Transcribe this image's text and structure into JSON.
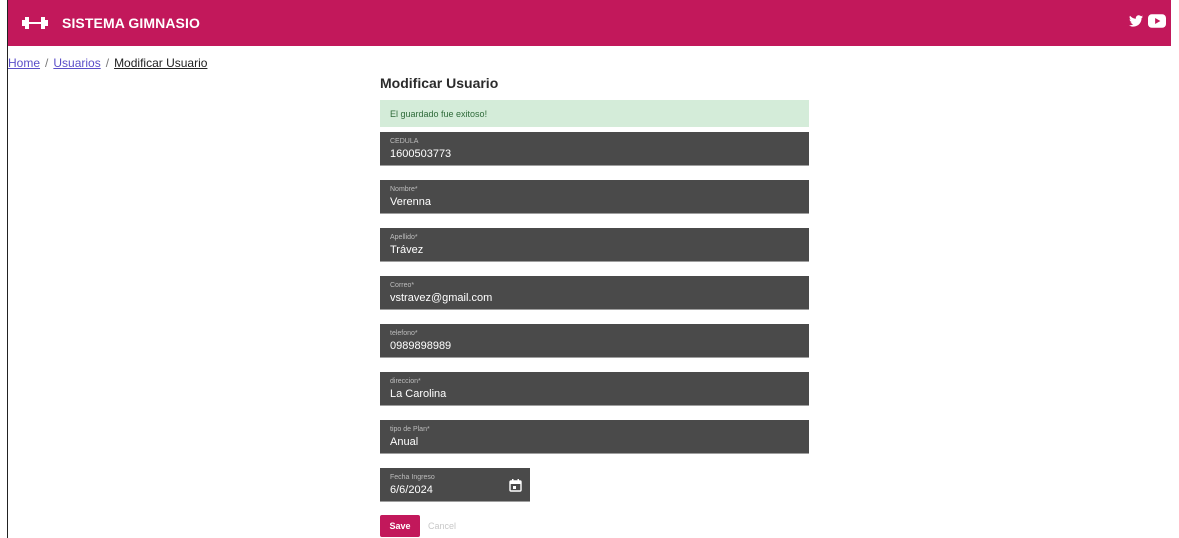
{
  "header": {
    "title": "SISTEMA GIMNASIO",
    "brand_icon": "dumbbell-icon",
    "social_icons": [
      "twitter-icon",
      "youtube-icon"
    ],
    "color": "#c2185b"
  },
  "breadcrumb": {
    "items": [
      "Home",
      "Usuarios",
      "Modificar Usuario"
    ],
    "separator": "/"
  },
  "form": {
    "title": "Modificar Usuario",
    "alert": "El guardado fue exitoso!",
    "fields": [
      {
        "label": "CEDULA",
        "value": "1600503773"
      },
      {
        "label": "Nombre*",
        "value": "Verenna"
      },
      {
        "label": "Apellido*",
        "value": "Trávez"
      },
      {
        "label": "Correo*",
        "value": "vstravez@gmail.com"
      },
      {
        "label": "telefono*",
        "value": "0989898989"
      },
      {
        "label": "direccion*",
        "value": "La Carolina"
      },
      {
        "label": "tipo de Plan*",
        "value": "Anual"
      },
      {
        "label": "Fecha Ingreso",
        "value": "6/6/2024"
      }
    ],
    "save_label": "Save",
    "cancel_label": "Cancel"
  }
}
